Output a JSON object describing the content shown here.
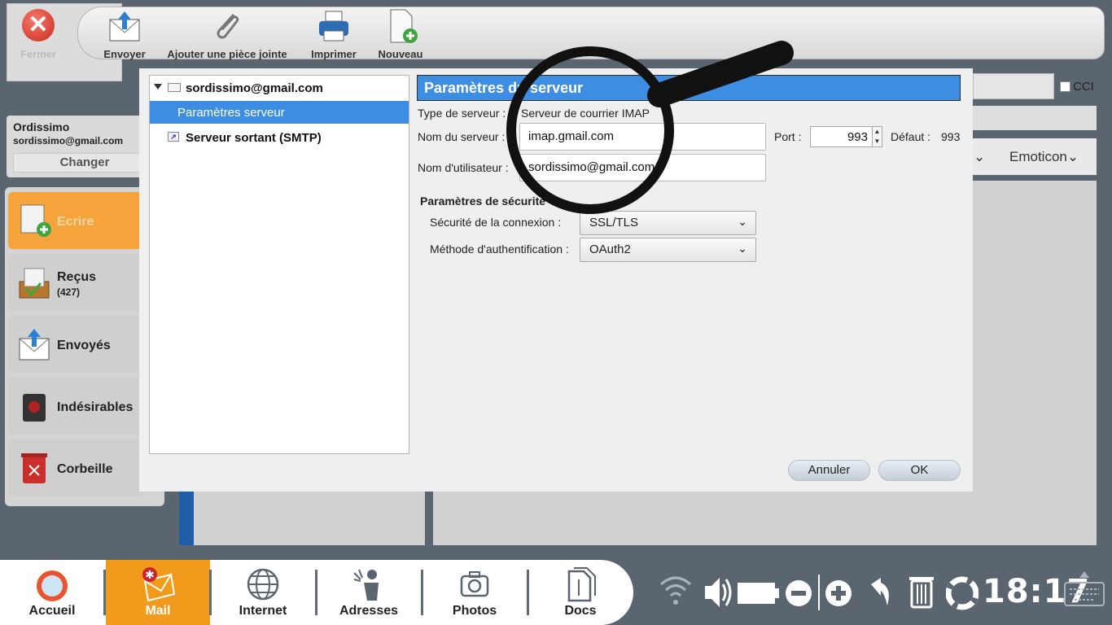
{
  "toolbar": {
    "fermer": "Fermer",
    "envoyer": "Envoyer",
    "ajouter": "Ajouter une pièce jointe",
    "imprimer": "Imprimer",
    "nouveau": "Nouveau"
  },
  "account": {
    "name": "Ordissimo",
    "email": "sordissimo@gmail.com",
    "change": "Changer"
  },
  "folders": [
    {
      "label": "Ecrire",
      "count": ""
    },
    {
      "label": "Reçus",
      "count": "(427)"
    },
    {
      "label": "Envoyés",
      "count": ""
    },
    {
      "label": "Indésirables",
      "count": ""
    },
    {
      "label": "Corbeille",
      "count": ""
    }
  ],
  "background": {
    "cci": "CCI",
    "emoticon": "Emoticon"
  },
  "dialog": {
    "tree": {
      "account": "sordissimo@gmail.com",
      "server_settings": "Paramètres serveur",
      "smtp": "Serveur sortant (SMTP)"
    },
    "panel_title": "Paramètres du serveur",
    "server_type_label": "Type de serveur :",
    "server_type_value": "Serveur de courrier IMAP",
    "server_name_label": "Nom du serveur :",
    "server_name_value": "imap.gmail.com",
    "port_label": "Port :",
    "port_value": "993",
    "default_label": "Défaut :",
    "default_value": "993",
    "username_label": "Nom d'utilisateur :",
    "username_value": "sordissimo@gmail.com",
    "security_title": "Paramètres de sécurité",
    "connection_security_label": "Sécurité de la connexion :",
    "connection_security_value": "SSL/TLS",
    "auth_method_label": "Méthode d'authentification :",
    "auth_method_value": "OAuth2",
    "cancel": "Annuler",
    "ok": "OK"
  },
  "taskbar": {
    "items": [
      "Accueil",
      "Mail",
      "Internet",
      "Adresses",
      "Photos",
      "Docs"
    ],
    "active": "Mail",
    "clock": "18:17"
  },
  "colors": {
    "accent_blue": "#3d8ee2",
    "taskbar_active": "#f29a1c",
    "desktop": "#5b6570"
  }
}
